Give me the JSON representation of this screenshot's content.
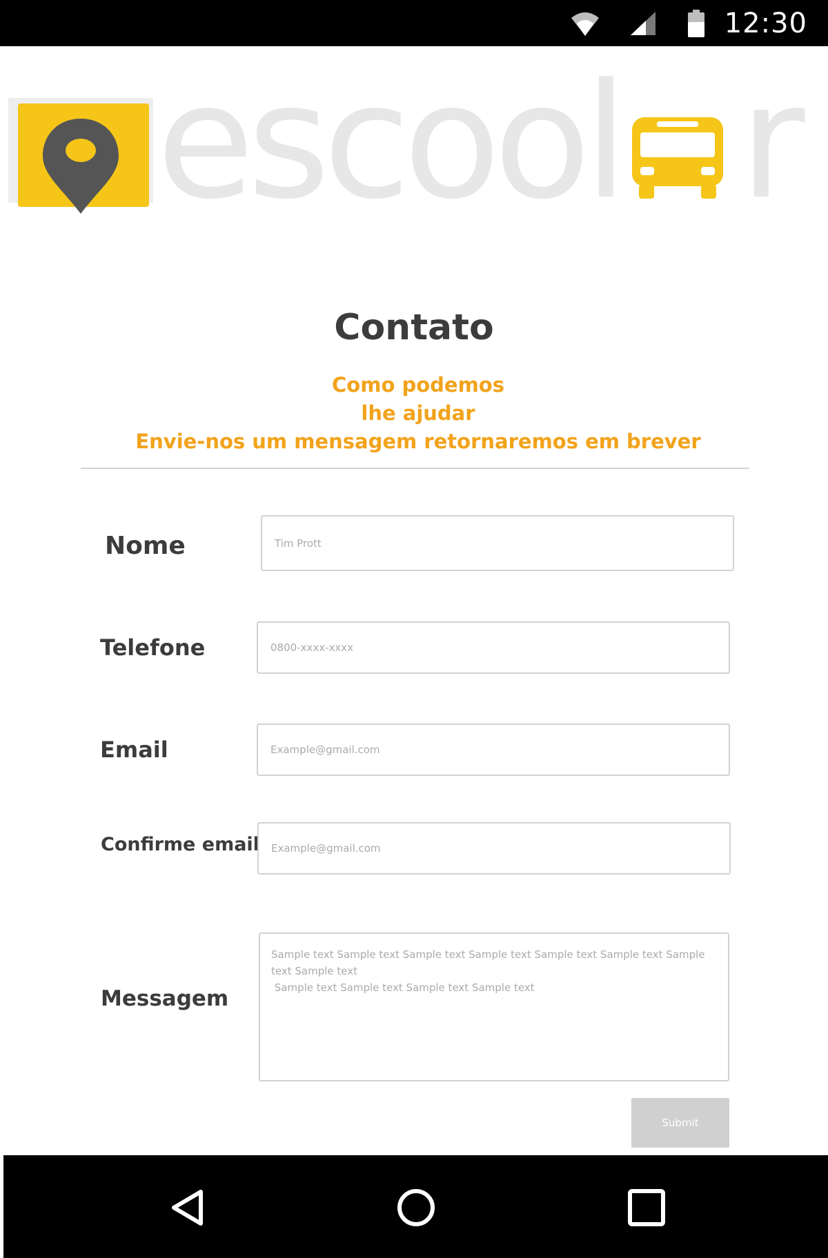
{
  "status_bar": {
    "time": "12:30",
    "icons": [
      "wifi-icon",
      "signal-icon",
      "battery-icon"
    ]
  },
  "logo": {
    "text": "escoolar",
    "accent_color": "#f5c518",
    "text_color": "#e7e7e7",
    "pin_color": "#555555"
  },
  "header": {
    "title": "Contato",
    "subtitle_lines": [
      "Como podemos",
      "lhe ajudar",
      "Envie-nos um mensagem retornaremos em brever"
    ],
    "subtitle_color": "#f2a31b"
  },
  "form": {
    "nome": {
      "label": "Nome",
      "value": "",
      "placeholder": "Tim Prott"
    },
    "telefone": {
      "label": "Telefone",
      "value": "",
      "placeholder": "0800-xxxx-xxxx"
    },
    "email": {
      "label": "Email",
      "value": "",
      "placeholder": "Example@gmail.com"
    },
    "confirme_email": {
      "label": "Confirme email",
      "value": "",
      "placeholder": "Example@gmail.com"
    },
    "mensagem": {
      "label": "Messagem",
      "value": "",
      "placeholder": "Sample text Sample text Sample text Sample text Sample text Sample text Sample text Sample text\n Sample text Sample text Sample text Sample text"
    },
    "submit_label": "Submit"
  },
  "nav_bar": {
    "buttons": [
      "back-icon",
      "home-icon",
      "recents-icon"
    ]
  }
}
